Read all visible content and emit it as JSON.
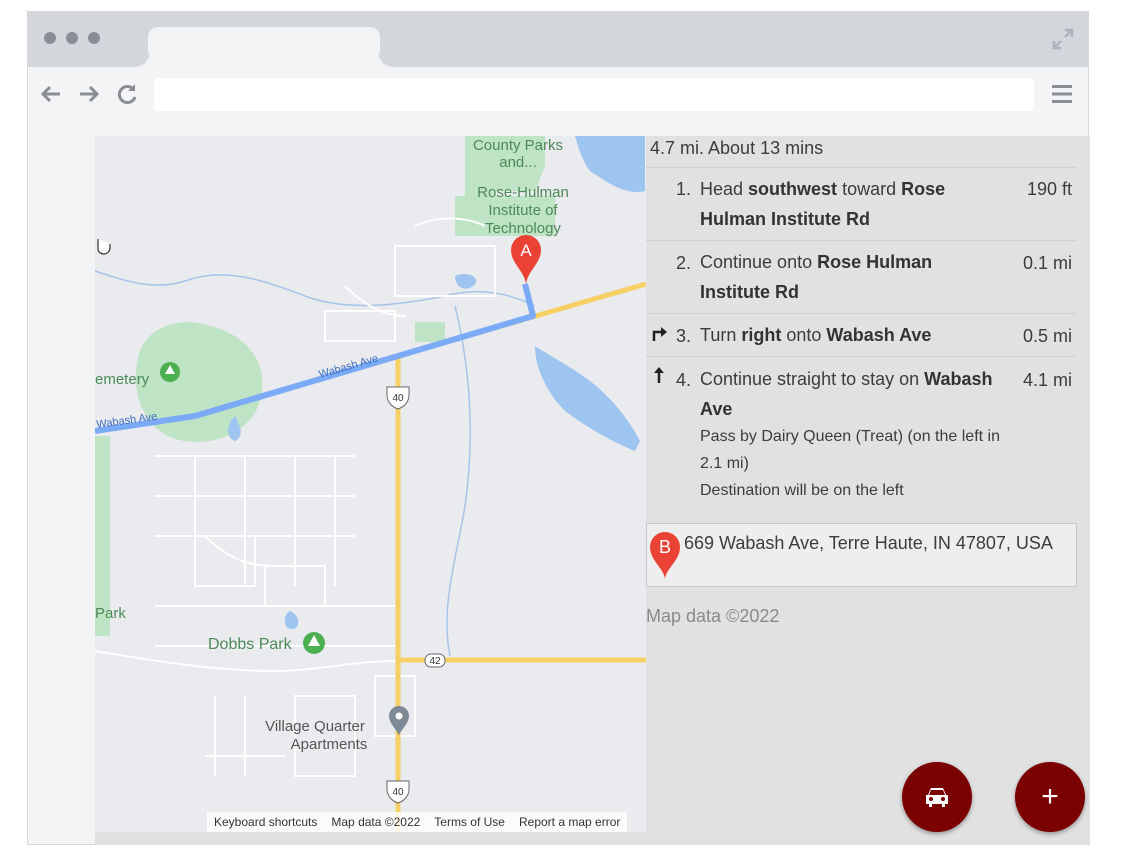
{
  "browser": {
    "url": "",
    "icons": [
      "window-dot",
      "expand-icon",
      "back-arrow-icon",
      "forward-arrow-icon",
      "reload-icon",
      "hamburger-menu-icon"
    ]
  },
  "map": {
    "labels": {
      "county_parks": "County Parks\nand...",
      "rose_hulman": "Rose-Hulman\nInstitute of\nTechnology",
      "cemetery": "emetery",
      "wabash_ave_1": "Wabash Ave",
      "wabash_ave_2": "Wabash Ave",
      "park": "Park",
      "dobbs_park": "Dobbs Park",
      "village_quarter": "Village Quarter\nApartments",
      "route_40_a": "40",
      "route_40_b": "40",
      "route_42": "42",
      "marker_a": "A"
    },
    "footer": {
      "shortcuts": "Keyboard shortcuts",
      "map_data": "Map data ©2022",
      "terms": "Terms of Use",
      "report": "Report a map error"
    },
    "colors": {
      "route": "#7baaf7",
      "highway": "#f6cf65",
      "water": "#9ec4f0",
      "park": "#bfe3c5",
      "marker": "#ea4335"
    }
  },
  "directions": {
    "summary": "4.7 mi. About 13 mins",
    "steps": [
      {
        "num": "1.",
        "pre": "Head ",
        "b1": "southwest",
        "mid": " toward ",
        "b2": "Rose Hulman Institute Rd",
        "dist": "190 ft"
      },
      {
        "num": "2.",
        "pre": "Continue onto ",
        "b1": "Rose Hulman Institute Rd",
        "dist": "0.1 mi"
      },
      {
        "num": "3.",
        "pre": "Turn ",
        "b1": "right",
        "mid": " onto ",
        "b2": "Wabash Ave",
        "dist": "0.5 mi",
        "icon": "turn-right-icon"
      },
      {
        "num": "4.",
        "pre": "Continue straight to stay on ",
        "b1": "Wabash Ave",
        "dist": "4.1 mi",
        "icon": "straight-arrow-icon",
        "note1": "Pass by Dairy Queen (Treat) (on the left in 2.1 mi)",
        "note2": "Destination will be on the left"
      }
    ],
    "destination": {
      "marker": "B",
      "address": "669 Wabash Ave, Terre Haute, IN 47807, USA"
    },
    "credit": "Map data ©2022"
  },
  "fabs": {
    "car": "car-icon",
    "add": "+"
  },
  "accent": "#7b0000"
}
